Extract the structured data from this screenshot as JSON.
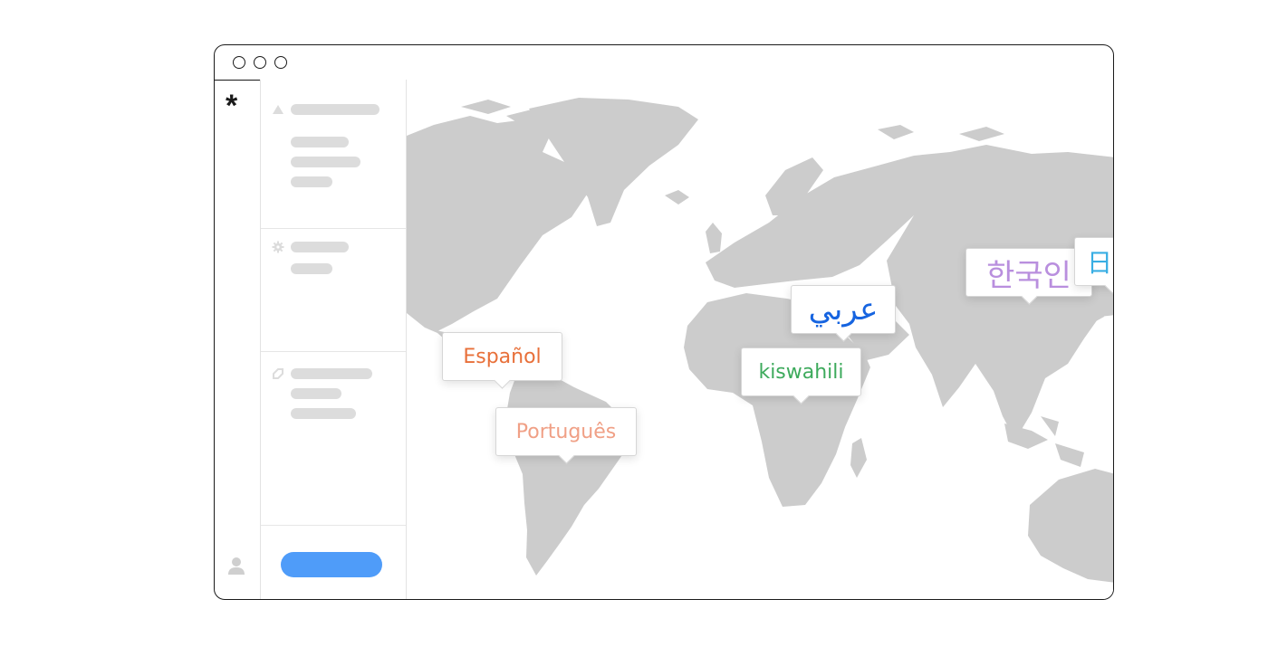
{
  "window": {
    "controls": [
      "close",
      "minimize",
      "maximize"
    ]
  },
  "rail": {
    "logo_icon": "asterisk-icon",
    "logo_glyph": "*",
    "bottom_icon": "user-icon"
  },
  "sidebar": {
    "sections": [
      {
        "icon": "triangle-icon"
      },
      {
        "icon": "gear-icon"
      },
      {
        "icon": "tag-icon"
      }
    ],
    "button_color": "#4f9cf9"
  },
  "map": {
    "land_color": "#cccccc",
    "languages": [
      {
        "label": "Español",
        "color": "#e8703a"
      },
      {
        "label": "Português",
        "color": "#f0a086"
      },
      {
        "label": "kiswahili",
        "color": "#3daa5c"
      },
      {
        "label": "عربي",
        "color": "#1664e0"
      },
      {
        "label": "한국인",
        "color": "#b98fde"
      },
      {
        "label": "日本",
        "color": "#39aee3"
      }
    ]
  }
}
